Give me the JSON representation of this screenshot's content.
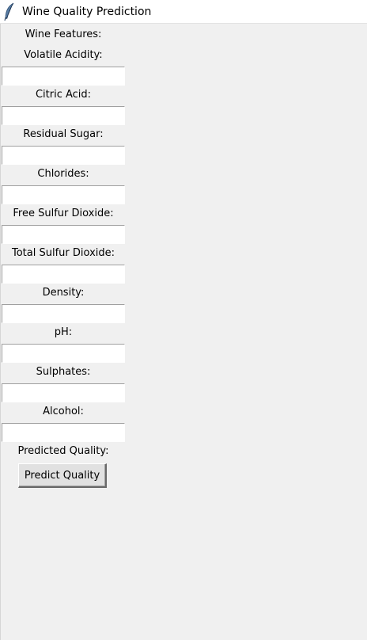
{
  "window": {
    "title": "Wine Quality Prediction",
    "icon": "feather-icon"
  },
  "form": {
    "header": "Wine Features:",
    "fields": [
      {
        "label": "Volatile Acidity:",
        "value": ""
      },
      {
        "label": "Citric Acid:",
        "value": ""
      },
      {
        "label": "Residual Sugar:",
        "value": ""
      },
      {
        "label": "Chlorides:",
        "value": ""
      },
      {
        "label": "Free Sulfur Dioxide:",
        "value": ""
      },
      {
        "label": "Total Sulfur Dioxide:",
        "value": ""
      },
      {
        "label": "Density:",
        "value": ""
      },
      {
        "label": "pH:",
        "value": ""
      },
      {
        "label": "Sulphates:",
        "value": ""
      },
      {
        "label": "Alcohol:",
        "value": ""
      }
    ],
    "result_label": "Predicted Quality:",
    "button_label": "Predict Quality"
  }
}
